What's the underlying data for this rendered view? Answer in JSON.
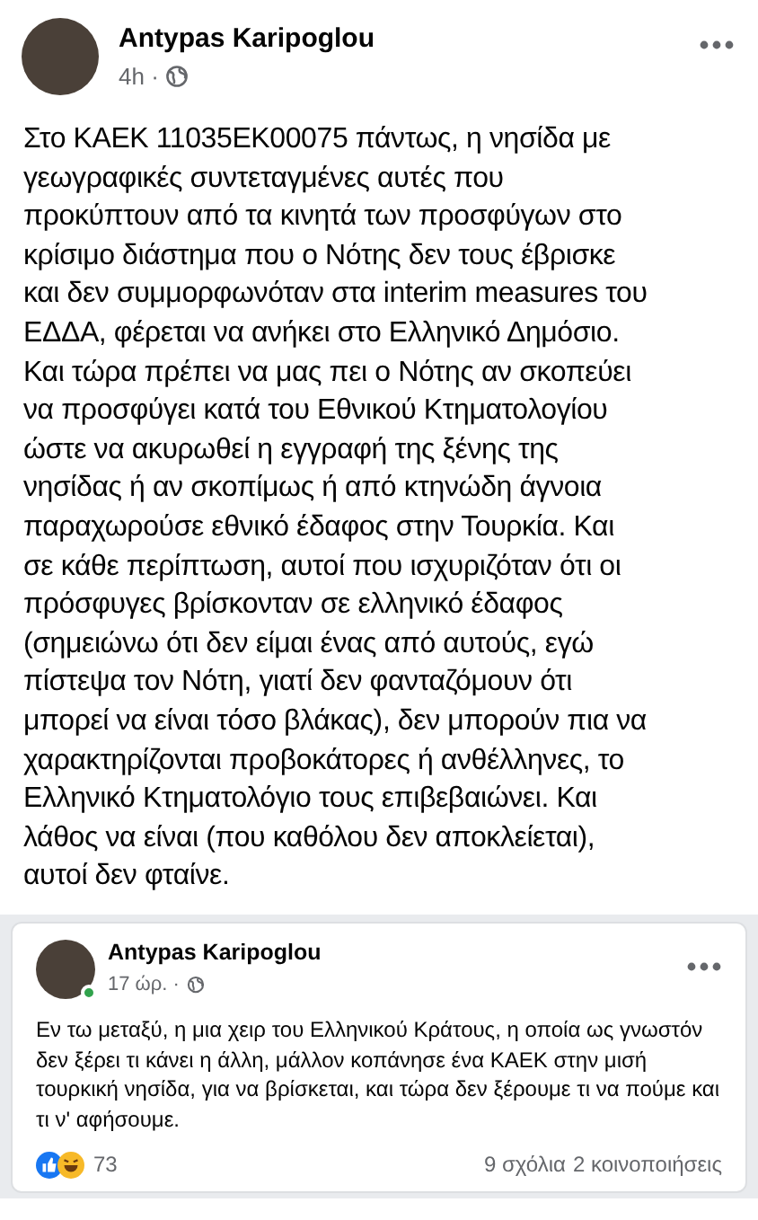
{
  "post": {
    "author": "Antypas Karipoglou",
    "time": "4h ·",
    "text": "Στο ΚΑΕΚ 11035ΕΚ00075 πάντως, η νησίδα με\nγεωγραφικές συντεταγμένες αυτές που\nπροκύπτουν από τα κινητά των προσφύγων στο\nκρίσιμο διάστημα που ο Νότης δεν τους έβρισκε\nκαι δεν συμμορφωνόταν στα interim measures του\nΕΔΔΑ, φέρεται να ανήκει στο Ελληνικό Δημόσιο.\nΚαι τώρα πρέπει να μας πει ο Νότης αν σκοπεύει\nνα προσφύγει κατά του Εθνικού Κτηματολογίου\nώστε να ακυρωθεί η εγγραφή της ξένης της\nνησίδας ή αν σκοπίμως ή από κτηνώδη άγνοια\nπαραχωρούσε εθνικό έδαφος στην Τουρκία. Και\nσε κάθε περίπτωση, αυτοί που ισχυριζόταν ότι οι\nπρόσφυγες βρίσκονταν σε ελληνικό έδαφος\n(σημειώνω ότι δεν είμαι ένας από αυτούς, εγώ\nπίστεψα τον Νότη, γιατί δεν φανταζόμουν ότι\nμπορεί να είναι τόσο βλάκας), δεν μπορούν πια να\nχαρακτηρίζονται προβοκάτορες ή ανθέλληνες, το\nΕλληνικό Κτηματολόγιο τους επιβεβαιώνει. Και\nλάθος να είναι (που καθόλου δεν αποκλείεται),\nαυτοί δεν φταίνε."
  },
  "shared_post": {
    "author": "Antypas Karipoglou",
    "online": true,
    "time": "17 ώρ. ·",
    "text": "Εν τω μεταξύ, η μια χειρ του Ελληνικού Κράτους, η οποία ως γνωστόν δεν ξέρει τι κάνει η άλλη, μάλλον κοπάνησε ένα ΚΑΕΚ στην μισή τουρκική νησίδα, για να βρίσκεται, και τώρα δεν ξέρουμε τι να πούμε και τι ν' αφήσουμε.",
    "reactions_count": "73",
    "comments": "9 σχόλια",
    "shares": "2 κοινοποιήσεις"
  }
}
